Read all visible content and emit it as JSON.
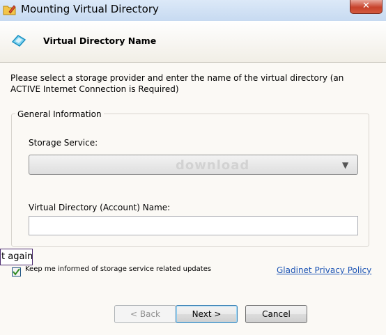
{
  "window": {
    "title": "Mounting Virtual Directory",
    "close_glyph": "✕",
    "title_icon": "folder-pencil-icon"
  },
  "header": {
    "title": "Virtual Directory Name",
    "icon": "cloud-icon"
  },
  "instructions": "Please select a storage provider and enter the name of the virtual directory (an ACTIVE Internet Connection is Required)",
  "group": {
    "title": "General Information",
    "storage_label": "Storage Service:",
    "storage_selected": "",
    "storage_arrow": "▼",
    "watermark": "download",
    "account_label": "Virtual Directory (Account) Name:",
    "account_value": ""
  },
  "tooltip": "t again",
  "checkbox": {
    "label": "Keep me informed of storage service related updates",
    "checked": true
  },
  "privacy_link": "Gladinet Privacy Policy",
  "buttons": {
    "back": "< Back",
    "next": "Next >",
    "cancel": "Cancel"
  }
}
